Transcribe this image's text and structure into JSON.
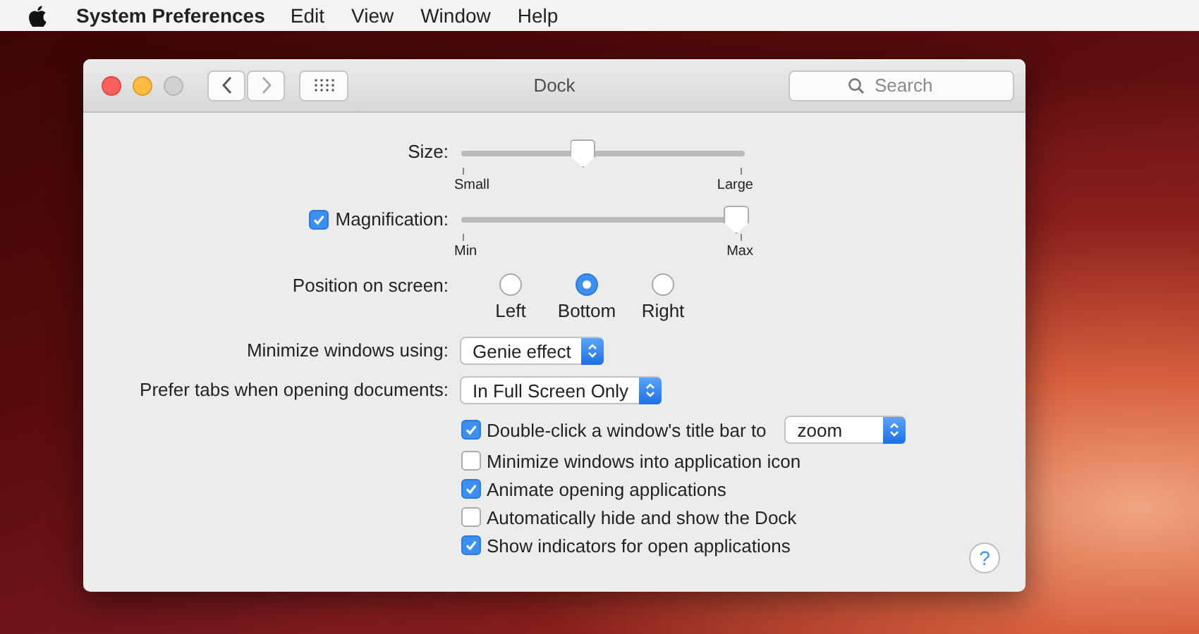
{
  "menu_bar": {
    "app_name": "System Preferences",
    "items": [
      "Edit",
      "View",
      "Window",
      "Help"
    ]
  },
  "window": {
    "title": "Dock",
    "search": {
      "placeholder": "Search"
    }
  },
  "size": {
    "label": "Size:",
    "level": 0.43,
    "min_label": "Small",
    "max_label": "Large"
  },
  "magnification": {
    "label": "Magnification:",
    "checked": true,
    "level": 0.97,
    "min_label": "Min",
    "max_label": "Max"
  },
  "position": {
    "label": "Position on screen:",
    "options": [
      {
        "label": "Left",
        "selected": false
      },
      {
        "label": "Bottom",
        "selected": true
      },
      {
        "label": "Right",
        "selected": false
      }
    ]
  },
  "minimize": {
    "label": "Minimize windows using:",
    "value": "Genie effect"
  },
  "prefer_tabs": {
    "label": "Prefer tabs when opening documents:",
    "value": "In Full Screen Only"
  },
  "options": [
    {
      "label": "Double-click a window's title bar to",
      "checked": true,
      "popup": "zoom"
    },
    {
      "label": "Minimize windows into application icon",
      "checked": false
    },
    {
      "label": "Animate opening applications",
      "checked": true
    },
    {
      "label": "Automatically hide and show the Dock",
      "checked": false
    },
    {
      "label": "Show indicators for open applications",
      "checked": true
    }
  ],
  "help": "?"
}
